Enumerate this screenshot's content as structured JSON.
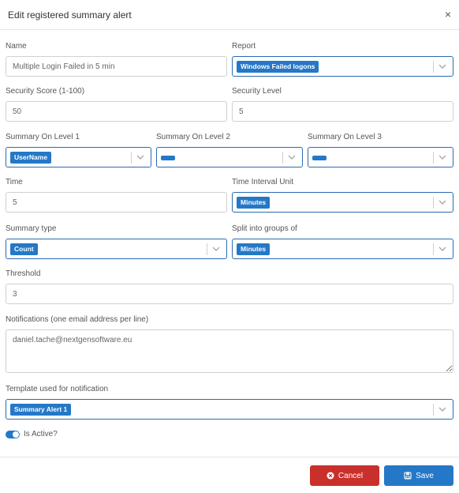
{
  "dialog": {
    "title": "Edit registered summary alert",
    "close_label": "×"
  },
  "fields": {
    "name": {
      "label": "Name",
      "value": "Multiple Login Failed in 5 min"
    },
    "report": {
      "label": "Report",
      "selected": "Windows Failed logons"
    },
    "security_score": {
      "label": "Security Score (1-100)",
      "value": "50"
    },
    "security_level": {
      "label": "Security Level",
      "value": "5"
    },
    "summary_level_1": {
      "label": "Summary On Level 1",
      "selected": "UserName"
    },
    "summary_level_2": {
      "label": "Summary On Level 2",
      "selected": ""
    },
    "summary_level_3": {
      "label": "Summary On Level 3",
      "selected": ""
    },
    "time": {
      "label": "Time",
      "value": "5"
    },
    "time_interval_unit": {
      "label": "Time Interval Unit",
      "selected": "Minutes"
    },
    "summary_type": {
      "label": "Summary type",
      "selected": "Count"
    },
    "split_groups": {
      "label": "Split into groups of",
      "selected": "Minutes"
    },
    "threshold": {
      "label": "Threshold",
      "value": "3"
    },
    "notifications": {
      "label": "Notifications (one email address per line)",
      "value": "daniel.tache@nextgensoftware.eu"
    },
    "template": {
      "label": "Template used for notification",
      "selected": "Summary Alert 1"
    }
  },
  "is_active": {
    "label": "Is Active?",
    "checked": true
  },
  "buttons": {
    "cancel": "Cancel",
    "save": "Save"
  },
  "colors": {
    "primary": "#2478c7",
    "danger": "#c9302c",
    "border": "#d0d0d0"
  }
}
